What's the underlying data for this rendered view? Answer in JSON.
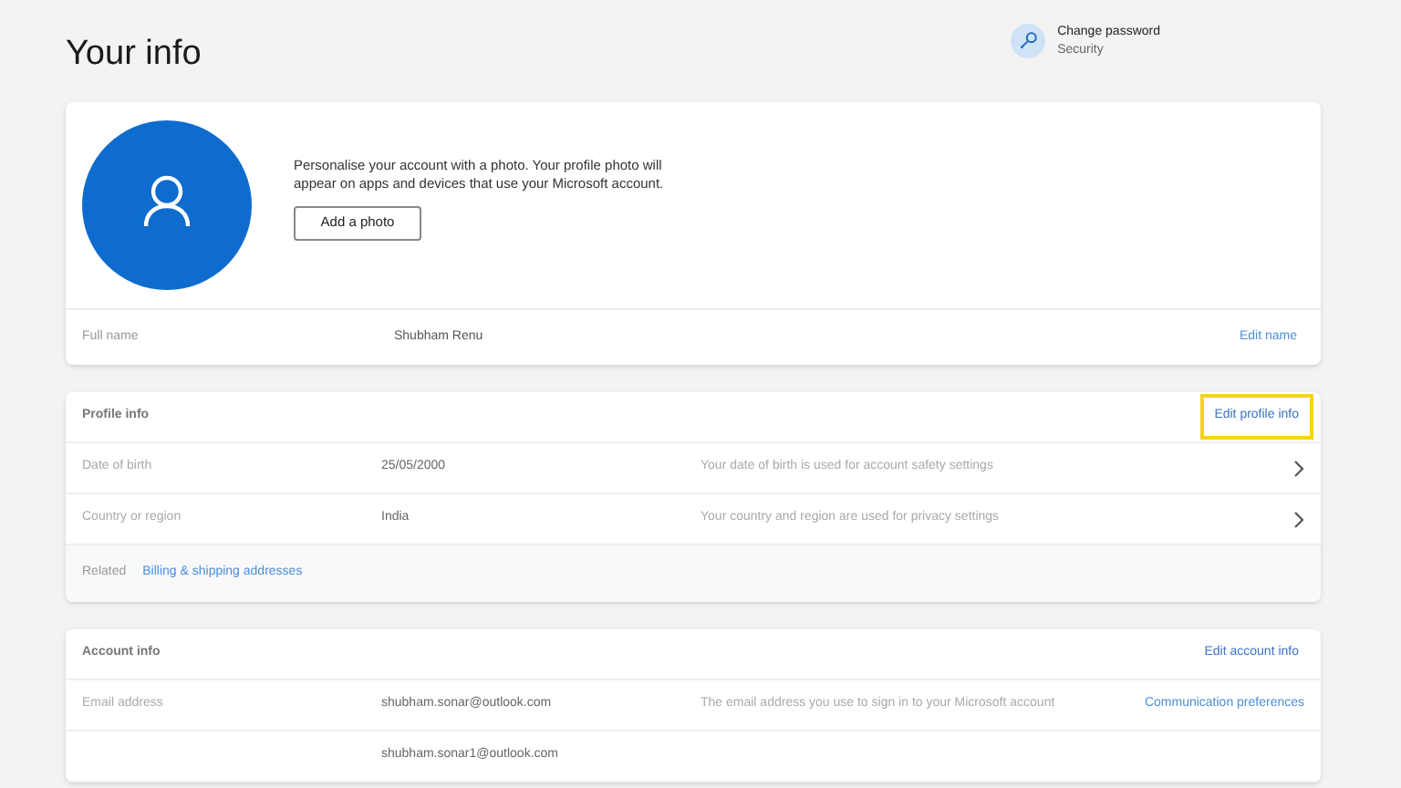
{
  "page_title": "Your info",
  "security_link": {
    "title": "Change password",
    "subtitle": "Security"
  },
  "photo_card": {
    "description": "Personalise your account with a photo. Your profile photo will appear on apps and devices that use your Microsoft account.",
    "button": "Add a photo",
    "full_name_label": "Full name",
    "full_name": "Shubham Renu",
    "edit_link": "Edit name"
  },
  "profile_info": {
    "title": "Profile info",
    "edit_link": "Edit profile info",
    "edit_link_highlighted": true,
    "rows": [
      {
        "label": "Date of birth",
        "value": "25/05/2000",
        "description": "Your date of birth is used for account safety settings"
      },
      {
        "label": "Country or region",
        "value": "India",
        "description": "Your country and region are used for privacy settings"
      }
    ],
    "related_label": "Related",
    "related_link": "Billing & shipping addresses"
  },
  "account_info": {
    "title": "Account info",
    "edit_link": "Edit account info",
    "rows": [
      {
        "label": "Email address",
        "value": "shubham.sonar@outlook.com",
        "description": "The email address you use to sign in to your Microsoft account",
        "link": "Communication preferences"
      },
      {
        "value": "shubham.sonar1@outlook.com"
      }
    ]
  }
}
